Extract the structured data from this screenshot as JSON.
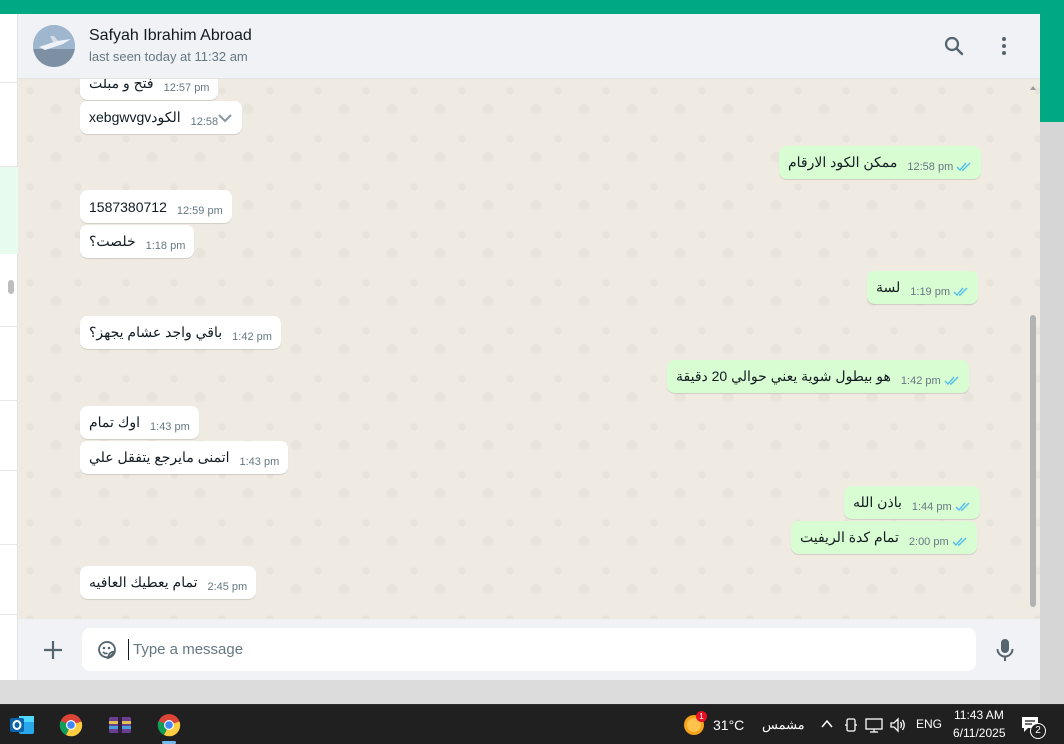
{
  "header": {
    "contact_name": "Safyah Ibrahim Abroad",
    "last_seen": "last seen today at 11:32 am"
  },
  "messages": [
    {
      "dir": "in",
      "text": "فتح و مبلت",
      "time": "12:57 pm"
    },
    {
      "dir": "in",
      "text": "xebgwvgvالكود",
      "time": "12:58"
    },
    {
      "dir": "out",
      "text": "ممكن الكود الارقام",
      "time": "12:58 pm"
    },
    {
      "dir": "in",
      "text": "1587380712",
      "time": "12:59 pm"
    },
    {
      "dir": "in",
      "text": "خلصت؟",
      "time": "1:18 pm"
    },
    {
      "dir": "out",
      "text": "لسة",
      "time": "1:19 pm"
    },
    {
      "dir": "in",
      "text": "باقي واجد عشام يجهز؟",
      "time": "1:42 pm"
    },
    {
      "dir": "out",
      "text": "هو بيطول شوية يعني حوالي 20 دقيقة",
      "time": "1:42 pm"
    },
    {
      "dir": "in",
      "text": "اوك تمام",
      "time": "1:43 pm"
    },
    {
      "dir": "in",
      "text": "اتمنى مايرجع يتفقل علي",
      "time": "1:43 pm"
    },
    {
      "dir": "out",
      "text": "باذن الله",
      "time": "1:44 pm"
    },
    {
      "dir": "out",
      "text": "تمام كدة الريفيت",
      "time": "2:00 pm"
    },
    {
      "dir": "in",
      "text": "تمام يعطيك العافيه",
      "time": "2:45 pm"
    }
  ],
  "composer": {
    "placeholder": "Type a message"
  },
  "taskbar": {
    "apps": [
      "outlook-icon",
      "chrome-icon",
      "winrar-icon",
      "chrome-icon"
    ],
    "weather_temp": "31°C",
    "weather_text": "مشمس",
    "weather_badge": "1",
    "lang": "ENG",
    "time": "11:43 AM",
    "date": "6/11/2025",
    "notification_count": "2"
  },
  "colors": {
    "brand": "#00a884",
    "incoming_bubble": "#ffffff",
    "outgoing_bubble": "#d9fdd3",
    "read_ticks": "#53bdeb",
    "chat_background": "#efeae2",
    "taskbar": "#202020"
  }
}
